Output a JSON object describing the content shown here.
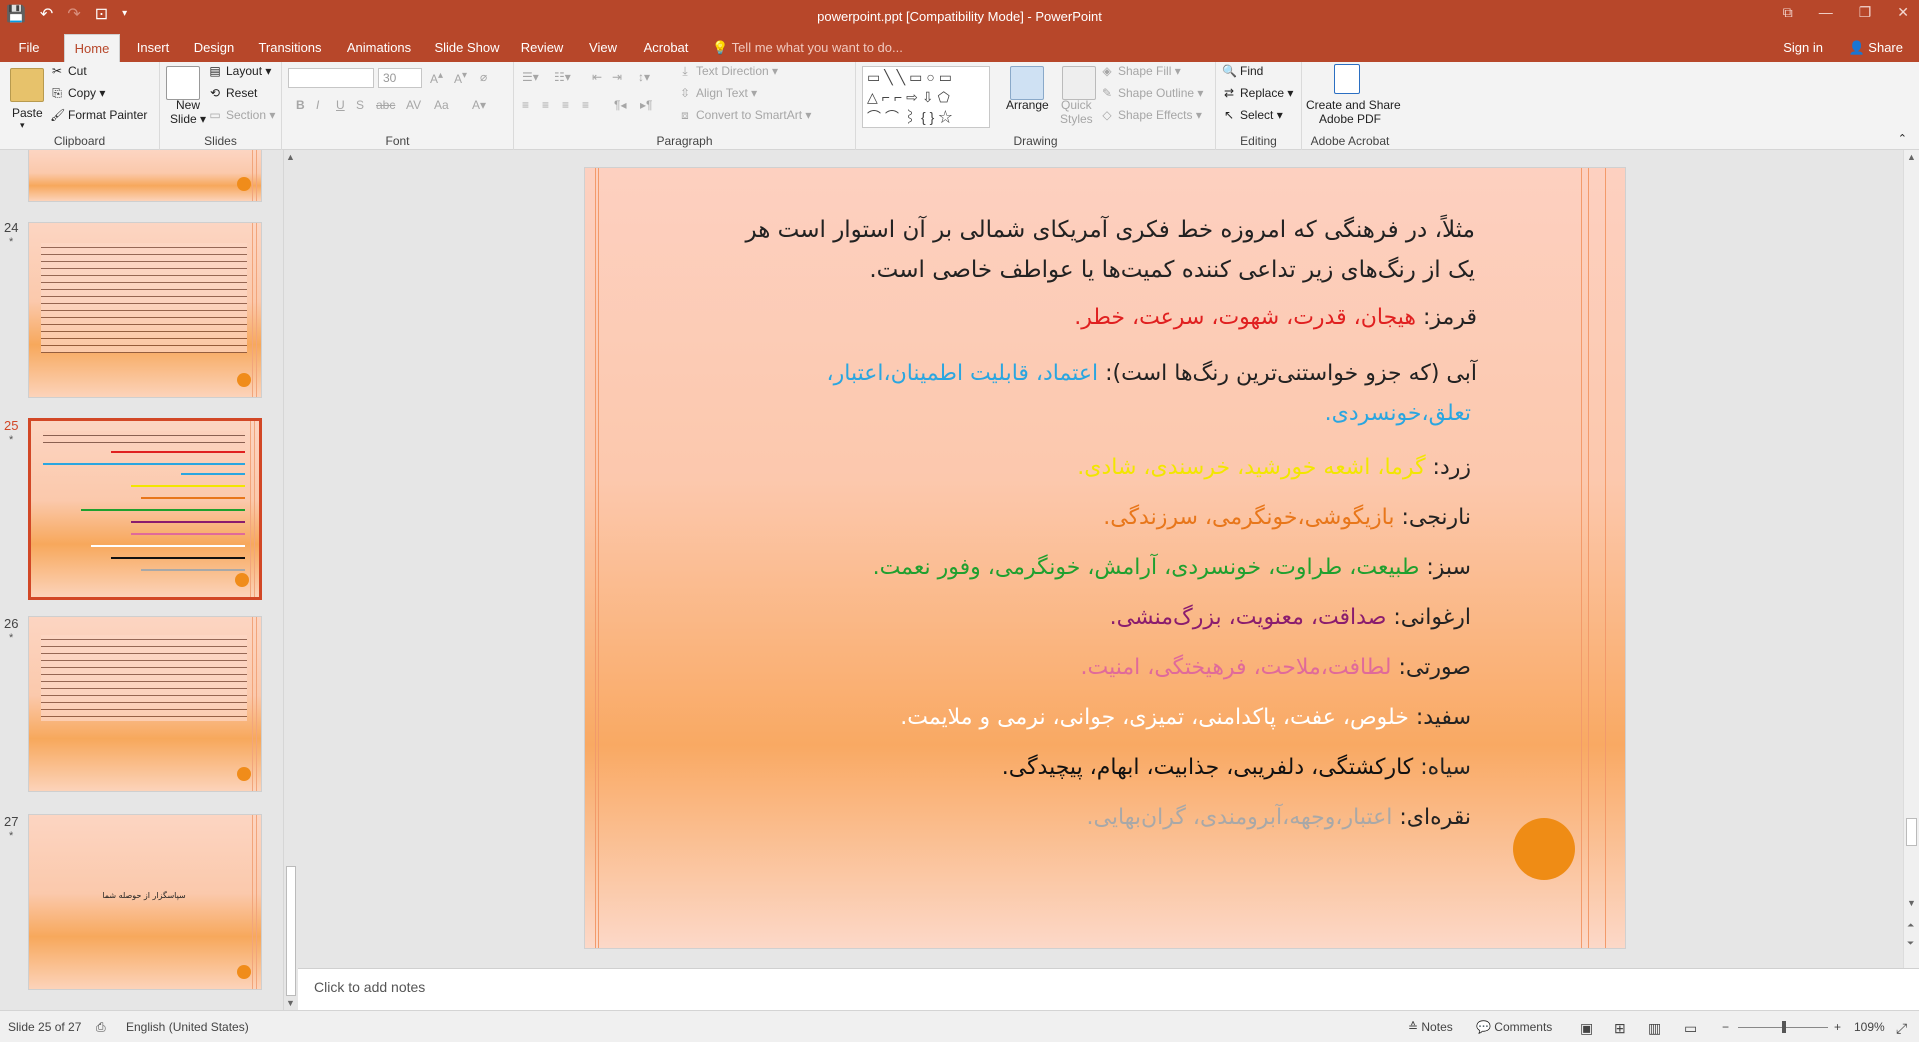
{
  "window": {
    "title": "powerpoint.ppt [Compatibility Mode] - PowerPoint",
    "accent": "#b7472a"
  },
  "tabs": [
    "File",
    "Home",
    "Insert",
    "Design",
    "Transitions",
    "Animations",
    "Slide Show",
    "Review",
    "View",
    "Acrobat"
  ],
  "active_tab": "Home",
  "tell_me": "Tell me what you want to do...",
  "sign_in": "Sign in",
  "share": "Share",
  "ribbon": {
    "clipboard": {
      "paste": "Paste",
      "cut": "Cut",
      "copy": "Copy",
      "format_painter": "Format Painter",
      "label": "Clipboard"
    },
    "slides": {
      "new_slide_1": "New",
      "new_slide_2": "Slide",
      "layout": "Layout",
      "reset": "Reset",
      "section": "Section",
      "label": "Slides"
    },
    "font": {
      "name": "",
      "size": "30",
      "label": "Font"
    },
    "paragraph": {
      "text_direction": "Text Direction",
      "align_text": "Align Text",
      "smartart": "Convert to SmartArt",
      "label": "Paragraph"
    },
    "drawing": {
      "arrange": "Arrange",
      "quick_styles_1": "Quick",
      "quick_styles_2": "Styles",
      "shape_fill": "Shape Fill",
      "shape_outline": "Shape Outline",
      "shape_effects": "Shape Effects",
      "label": "Drawing"
    },
    "editing": {
      "find": "Find",
      "replace": "Replace",
      "select": "Select",
      "label": "Editing"
    },
    "acrobat": {
      "create_1": "Create and Share",
      "create_2": "Adobe PDF",
      "label": "Adobe Acrobat"
    }
  },
  "thumbnails": [
    {
      "num": "24",
      "star": "*"
    },
    {
      "num": "25",
      "star": "*"
    },
    {
      "num": "26",
      "star": "*"
    },
    {
      "num": "27",
      "star": "*",
      "text": "سپاسگزار از حوصله شما"
    }
  ],
  "slide": {
    "intro_1": "مثلاً، در فرهنگی که امروزه خط فکری آمریکای شمالی بر آن استوار است هر",
    "intro_2": "یک از رنگ‌های زیر تداعی کننده کمیت‌ها یا عواطف خاصی است.",
    "lines": [
      {
        "label": "قرمز: ",
        "value": "هیجان، قدرت، شهوت، سرعت، خطر.",
        "color": "#e02020"
      },
      {
        "label": "آبی (که جزو خواستنی‌ترین رنگ‌ها است): ",
        "value": "اعتماد، قابلیت اطمینان،اعتبار،",
        "color": "#2aa6e0"
      },
      {
        "label": "",
        "value": "تعلق،خونسردی.",
        "color": "#2aa6e0"
      },
      {
        "label": "زرد: ",
        "value": "گرما، اشعه خورشید، خرسندی، شادی.",
        "color": "#f2e600"
      },
      {
        "label": "نارنجی: ",
        "value": "بازیگوشی،خونگرمی، سرزندگی.",
        "color": "#e8761a"
      },
      {
        "label": "سبز: ",
        "value": "طبیعت، طراوت، خونسردی، آرامش، خونگرمی، وفور نعمت.",
        "color": "#1fa02f"
      },
      {
        "label": "ارغوانی: ",
        "value": "صداقت، معنویت، بزرگ‌منشی.",
        "color": "#8a1c6e"
      },
      {
        "label": "صورتی: ",
        "value": "لطافت،ملاحت، فرهیختگی، امنیت.",
        "color": "#e06a9a"
      },
      {
        "label": "سفید: ",
        "value": "خلوص، عفت، پاکدامنی، تمیزی، جوانی، نرمی و ملایمت.",
        "color": "#ffffff"
      },
      {
        "label": "سیاه: ",
        "value": "کارکشتگی، دلفریبی، جذابیت، ابهام، پیچیدگی.",
        "color": "#111111"
      },
      {
        "label": "نقره‌ای: ",
        "value": "اعتبار،وجهه،آبرومندی، گران‌بهایی.",
        "color": "#a8a8a8"
      }
    ]
  },
  "notes_placeholder": "Click to add notes",
  "status": {
    "slide": "Slide 25 of 27",
    "language": "English (United States)",
    "notes": "Notes",
    "comments": "Comments",
    "zoom": "109%"
  }
}
